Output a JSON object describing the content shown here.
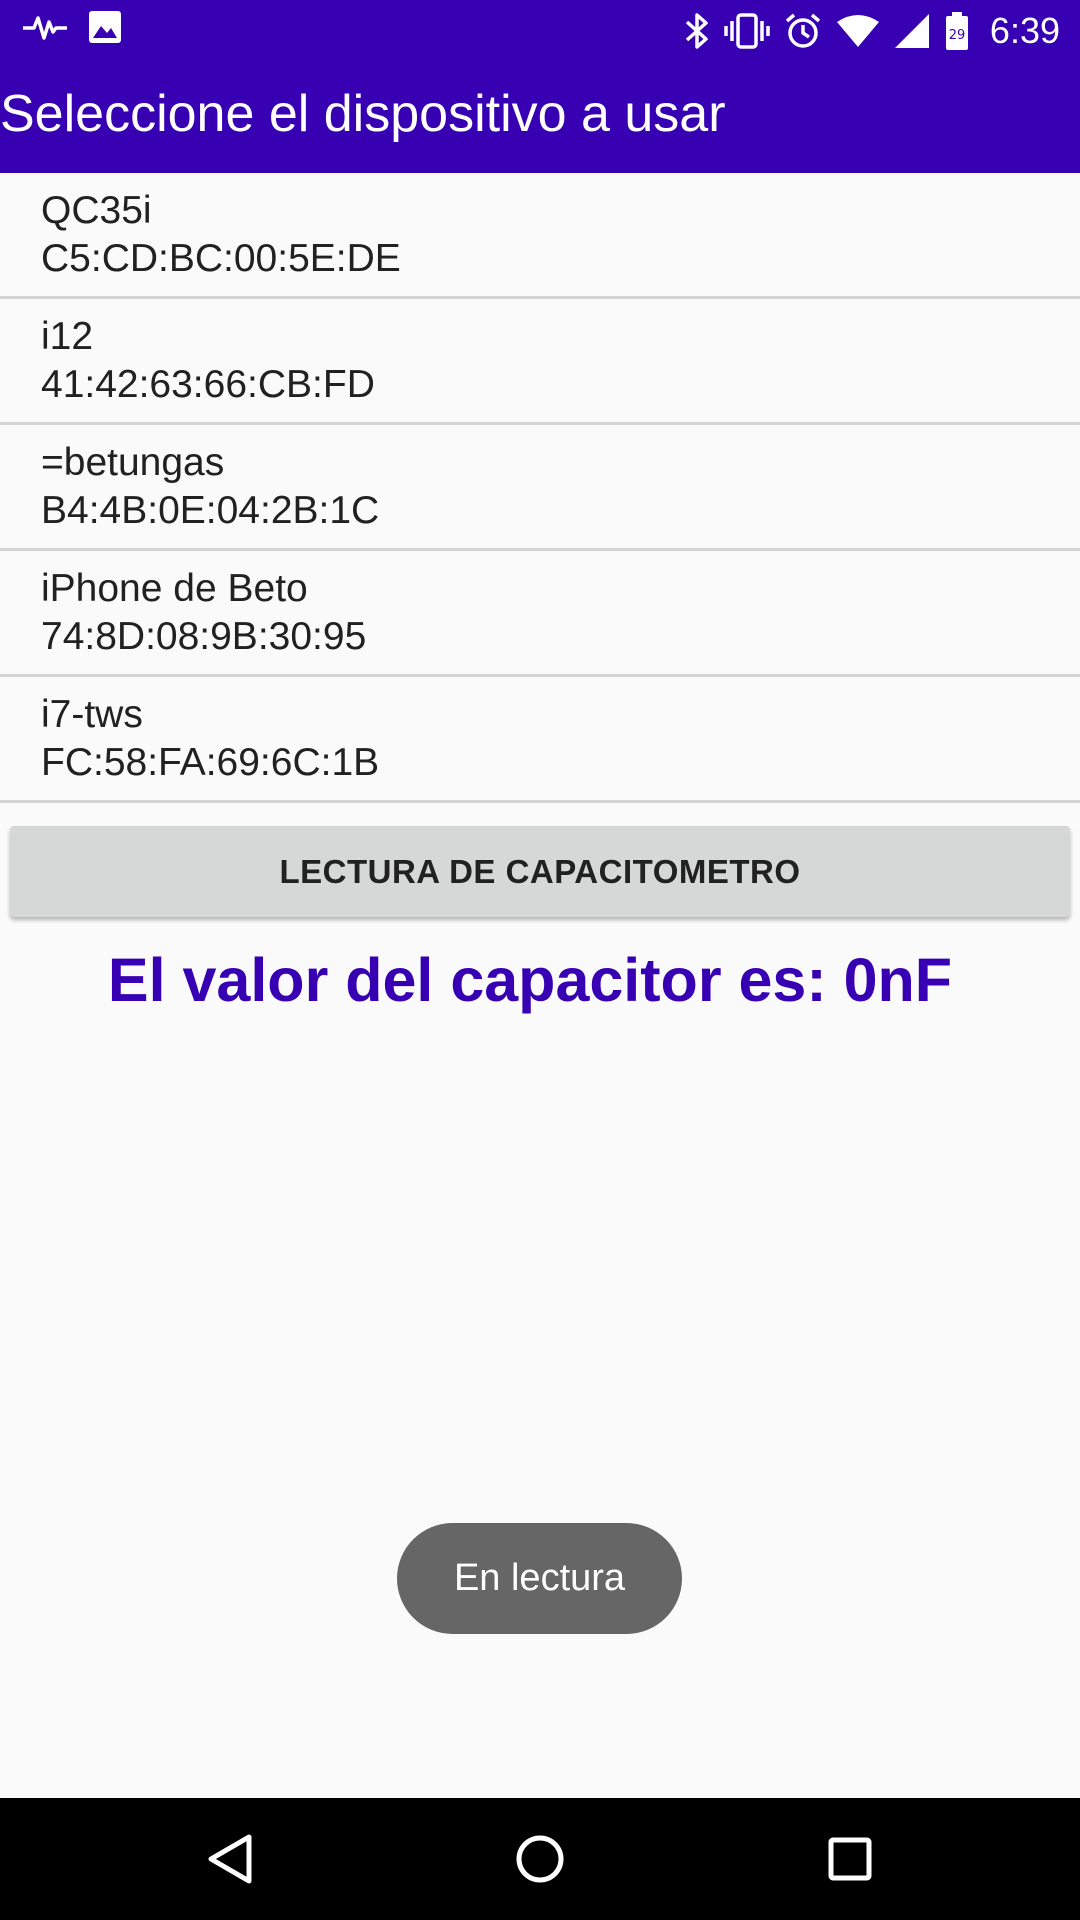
{
  "status_bar": {
    "time": "6:39",
    "battery_level": "29",
    "icons_left": [
      "pulse-icon",
      "image-icon"
    ],
    "icons_right": [
      "bluetooth-icon",
      "vibrate-icon",
      "alarm-icon",
      "wifi-icon",
      "signal-icon",
      "battery-icon"
    ]
  },
  "app_bar": {
    "title": "Seleccione el dispositivo a usar"
  },
  "devices": [
    {
      "name": "QC35i",
      "address": "C5:CD:BC:00:5E:DE"
    },
    {
      "name": "i12",
      "address": "41:42:63:66:CB:FD"
    },
    {
      "name": "=betungas",
      "address": "B4:4B:0E:04:2B:1C"
    },
    {
      "name": "iPhone de Beto",
      "address": "74:8D:08:9B:30:95"
    },
    {
      "name": "i7-tws",
      "address": "FC:58:FA:69:6C:1B"
    }
  ],
  "read_button_label": "LECTURA DE CAPACITOMETRO",
  "capacitor_text": "El valor del capacitor es: 0nF",
  "toast": "En lectura",
  "colors": {
    "primary": "#3700b3",
    "button": "#d6d7d7",
    "toast": "#666666"
  },
  "nav_bar": {
    "icons": [
      "back-icon",
      "home-icon",
      "recents-icon"
    ]
  }
}
